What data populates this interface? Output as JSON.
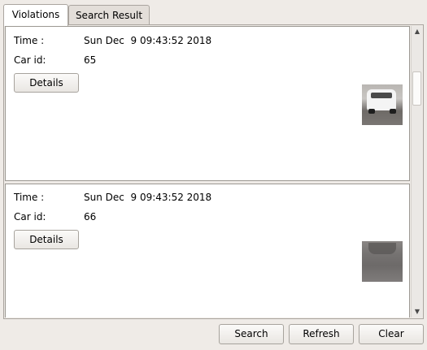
{
  "tabs": [
    {
      "label": "Violations",
      "active": true
    },
    {
      "label": "Search Result",
      "active": false
    }
  ],
  "violations": [
    {
      "time_label": "Time :",
      "time_value": "Sun Dec  9 09:43:52 2018",
      "car_label": "Car id:",
      "car_value": "65",
      "details_label": "Details",
      "thumb": "car-photo"
    },
    {
      "time_label": "Time :",
      "time_value": "Sun Dec  9 09:43:52 2018",
      "car_label": "Car id:",
      "car_value": "66",
      "details_label": "Details",
      "thumb": "car-photo"
    }
  ],
  "scrollbar": {
    "up_icon": "arrow-up-icon",
    "down_icon": "arrow-down-icon"
  },
  "buttons": {
    "search": "Search",
    "refresh": "Refresh",
    "clear": "Clear"
  }
}
